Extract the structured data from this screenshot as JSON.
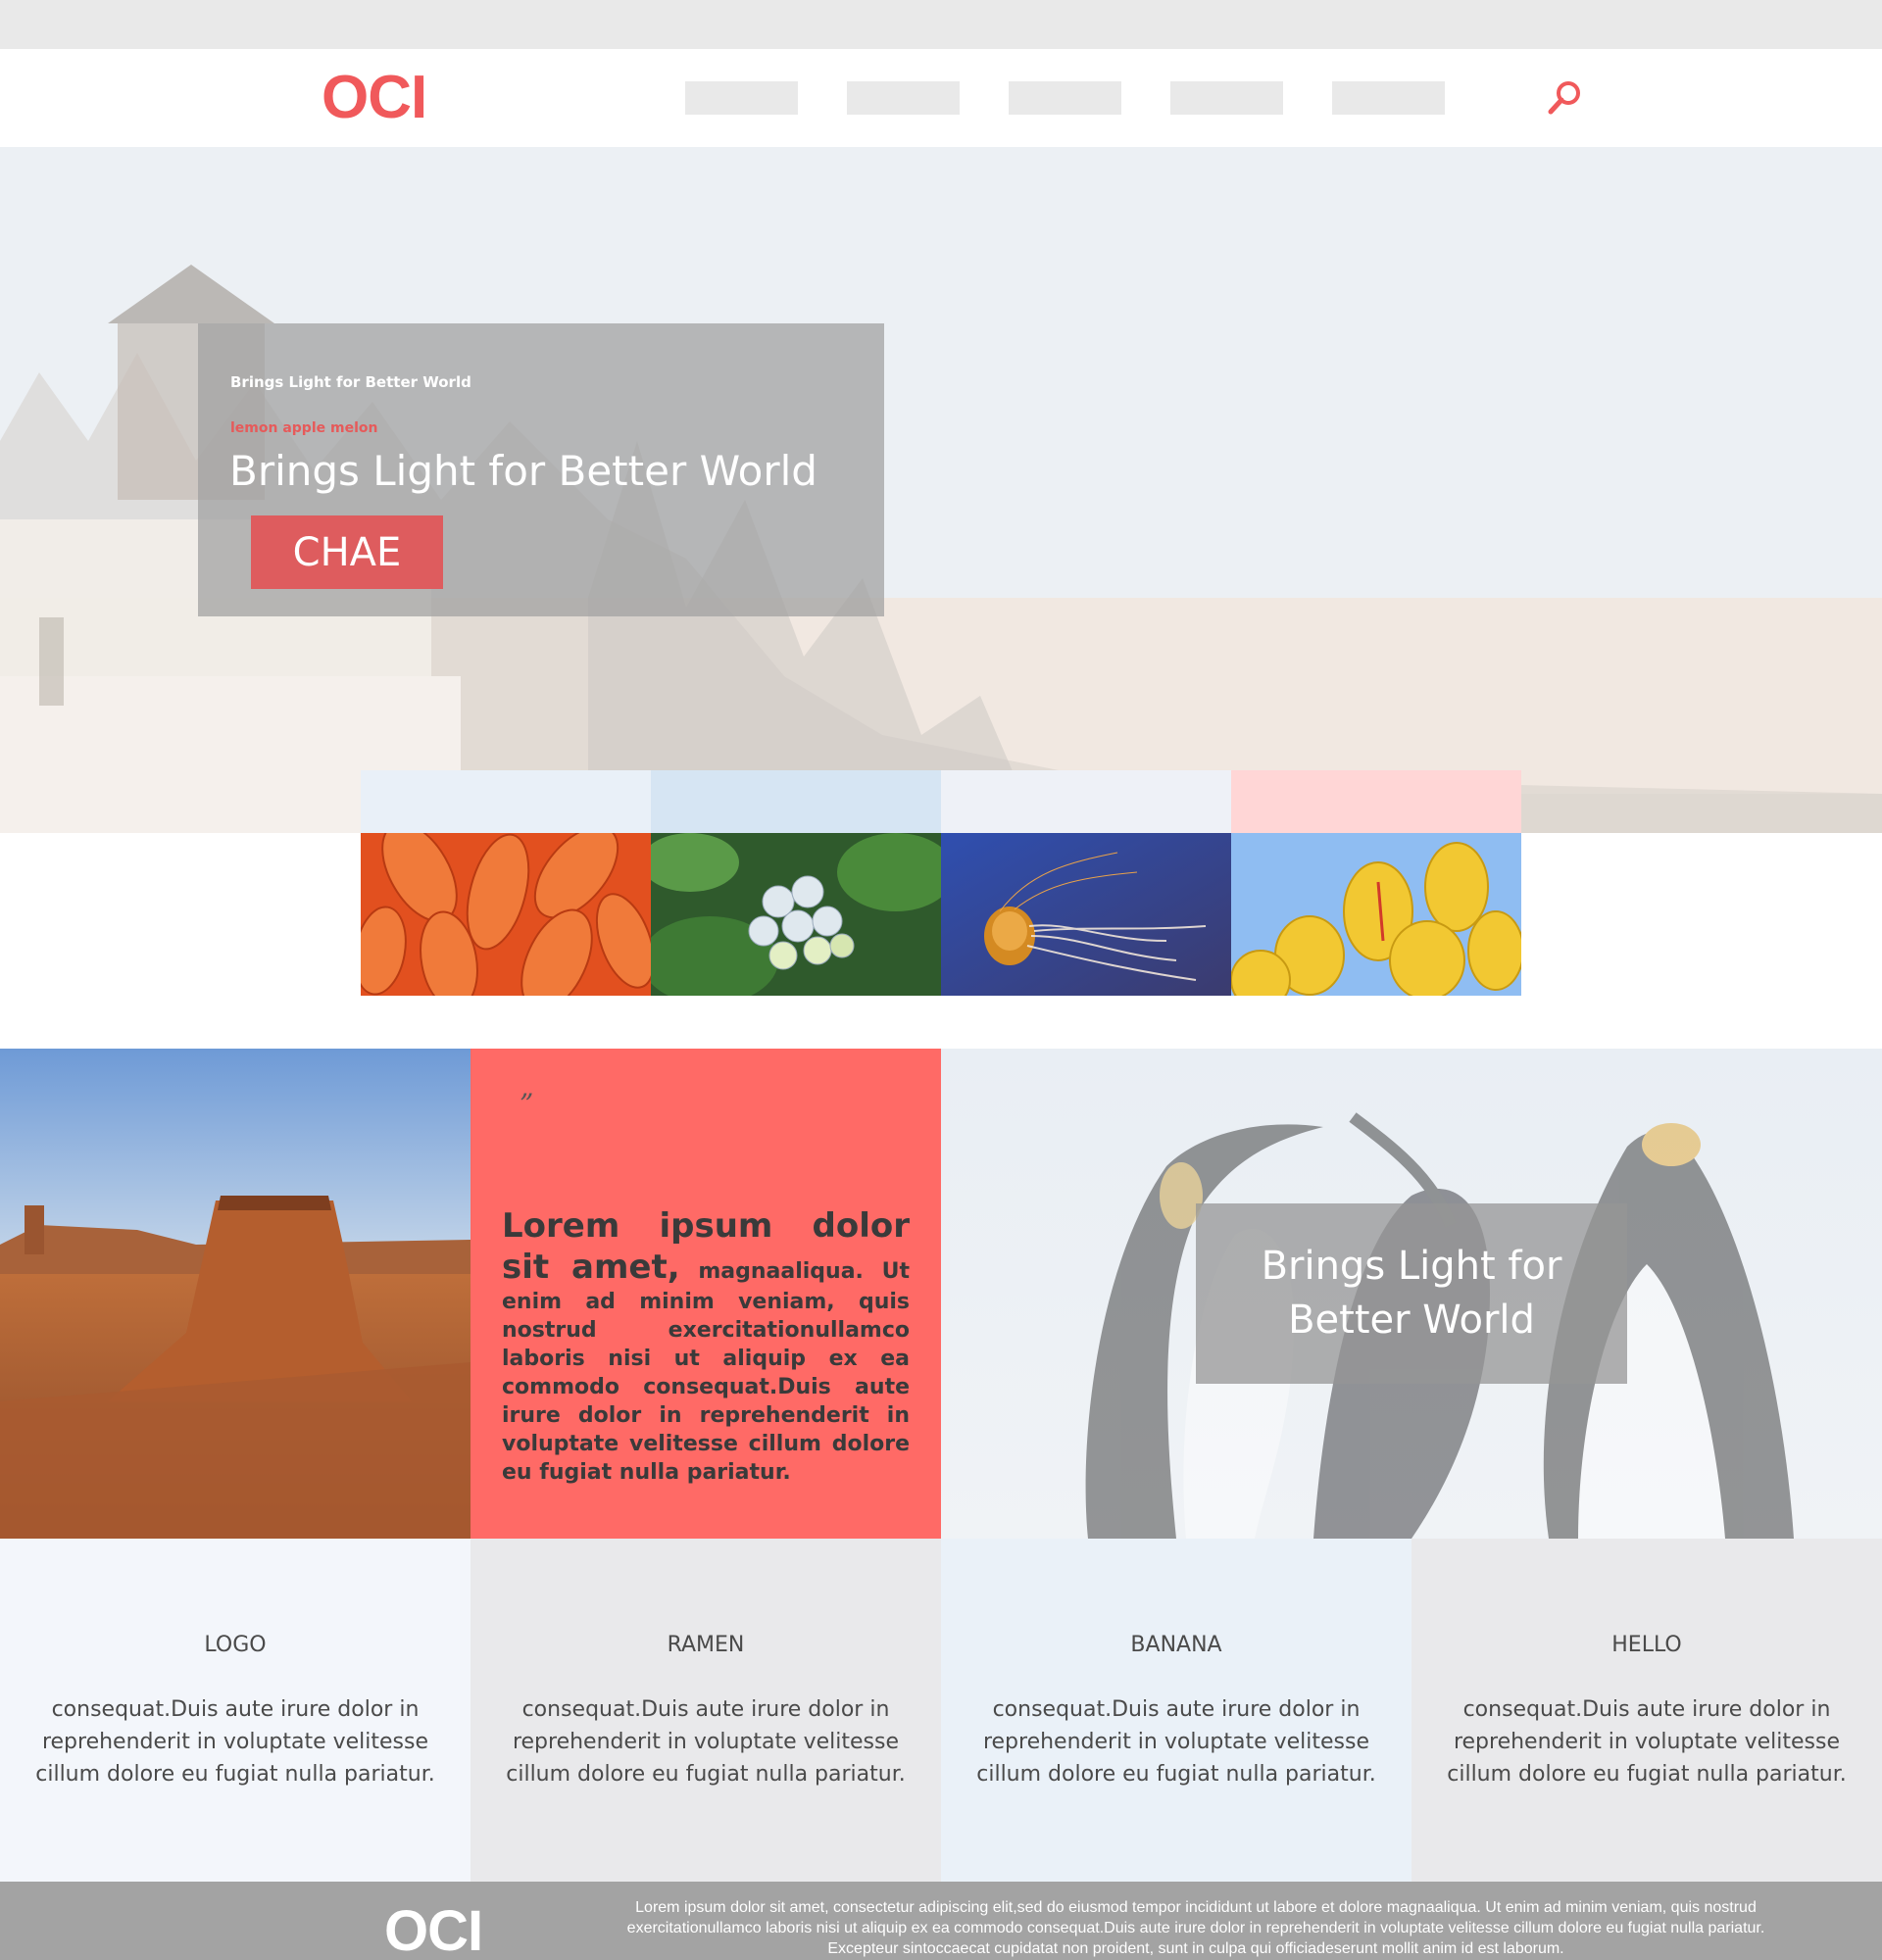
{
  "header": {
    "logo": "OCI",
    "nav_items": [
      "",
      "",
      "",
      "",
      ""
    ],
    "search_icon": "search-icon"
  },
  "hero": {
    "small_label": "Brings Light for Better World",
    "tag": "lemon apple melon",
    "title": "Brings Light for Better World",
    "button_label": "CHAE"
  },
  "gallery": {
    "tiles": [
      {
        "image": "orange-flower",
        "accent": "#e9f0f8"
      },
      {
        "image": "hydrangea",
        "accent": "#d6e5f3"
      },
      {
        "image": "jellyfish",
        "accent": "#eef1f7"
      },
      {
        "image": "yellow-tulips",
        "accent": "#ffd6d6"
      }
    ]
  },
  "feature": {
    "quote_mark": "”",
    "quote_lead": "Lorem ipsum dolor sit amet,",
    "quote_body": " magnaaliqua. Ut enim ad minim veniam, quis nostrud exercitationullamco laboris nisi ut aliquip ex ea commodo consequat.Duis aute irure dolor in reprehenderit in voluptate velitesse cillum dolore eu fugiat nulla pariatur.",
    "penguin_caption": "Brings Light for Better World"
  },
  "columns": [
    {
      "title": "LOGO",
      "body": "consequat.Duis aute irure dolor in reprehenderit in voluptate velitesse cillum dolore eu fugiat nulla pariatur."
    },
    {
      "title": "RAMEN",
      "body": "consequat.Duis aute irure dolor in reprehenderit in voluptate velitesse cillum dolore eu fugiat nulla pariatur."
    },
    {
      "title": "BANANA",
      "body": "consequat.Duis aute irure dolor in reprehenderit in voluptate velitesse cillum dolore eu fugiat nulla pariatur."
    },
    {
      "title": "HELLO",
      "body": "consequat.Duis aute irure dolor in reprehenderit in voluptate velitesse cillum dolore eu fugiat nulla pariatur."
    }
  ],
  "footer": {
    "logo": "OCI",
    "text": "Lorem ipsum dolor sit amet, consectetur adipiscing elit,sed do eiusmod tempor incididunt ut labore et dolore magnaaliqua. Ut enim ad minim veniam, quis nostrud exercitationullamco laboris nisi ut aliquip ex ea commodo consequat.Duis aute irure dolor in reprehenderit in voluptate velitesse cillum dolore eu fugiat nulla pariatur. Excepteur sintoccaecat cupidatat non proident, sunt in culpa qui officiadeserunt mollit anim id est laborum."
  },
  "colors": {
    "brand": "#f0595b",
    "button": "#de5c5e",
    "quote_panel": "#ff6a66",
    "nav_placeholder": "#e9e9e9",
    "footer": "#a3a3a3"
  }
}
